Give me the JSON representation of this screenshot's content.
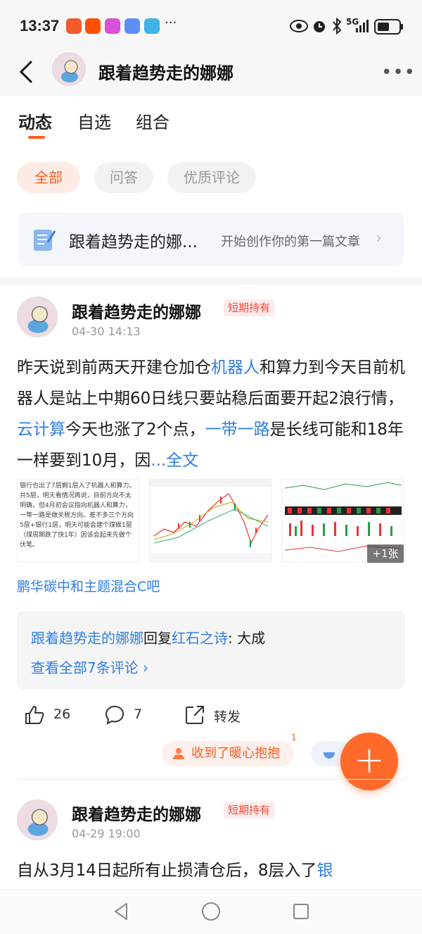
{
  "status": {
    "time": "13:37",
    "right": "5G"
  },
  "header": {
    "title": "跟着趋势走的娜娜",
    "more": "•••"
  },
  "tabs": [
    {
      "label": "动态"
    },
    {
      "label": "自选"
    },
    {
      "label": "组合"
    }
  ],
  "chips": [
    {
      "label": "全部"
    },
    {
      "label": "问答"
    },
    {
      "label": "优质评论"
    }
  ],
  "banner": {
    "title": "跟着趋势走的娜...",
    "subtitle": "开始创作你的第一篇文章",
    "chevron": "›"
  },
  "post1": {
    "author": "跟着趋势走的娜娜",
    "tag": "短期持有",
    "date": "04-30 14:13",
    "text_parts": [
      "昨天说到前两天开建仓加仓",
      "机器人",
      "和算力到今天目前机器人是站上中期60日线只要站稳后面要开起2浪行情，",
      "云计算",
      "今天也涨了2个点，",
      "一带一路",
      "是长线可能和18年一样要到10月，因",
      "...全文"
    ],
    "img1_text": "银行也出了7层剩1层入了机器人和算力。共5层，明天看情况再说，目前方向不太明确，但4月初会议指向机器人和算力，一带一路是做关税方向。差不多三个方向5层+银行1层，明天可能会建个煤碳1层（煤周期跌了快1年）因该会起来先做个伏笔。",
    "img_more": "+1张",
    "fund": "鹏华碳中和主题混合C吧",
    "comment": {
      "replier": "跟着趋势走的娜娜",
      "reply_word": "回复",
      "target": "红石之诗",
      "content": ": 大成",
      "view_all": "查看全部7条评论 ›"
    },
    "likes": "26",
    "comments": "7",
    "share": "转发",
    "warm": "收到了暖心抱抱",
    "warm_count": "1"
  },
  "post2": {
    "author": "跟着趋势走的娜娜",
    "tag": "短期持有",
    "date": "04-29 19:00",
    "text_parts": [
      "自从3月14日起所有止损清仓后，8层入了",
      "银"
    ]
  },
  "fab": "+",
  "colors": {
    "accent": "#ff5a1f",
    "link": "#2f7ee8"
  }
}
